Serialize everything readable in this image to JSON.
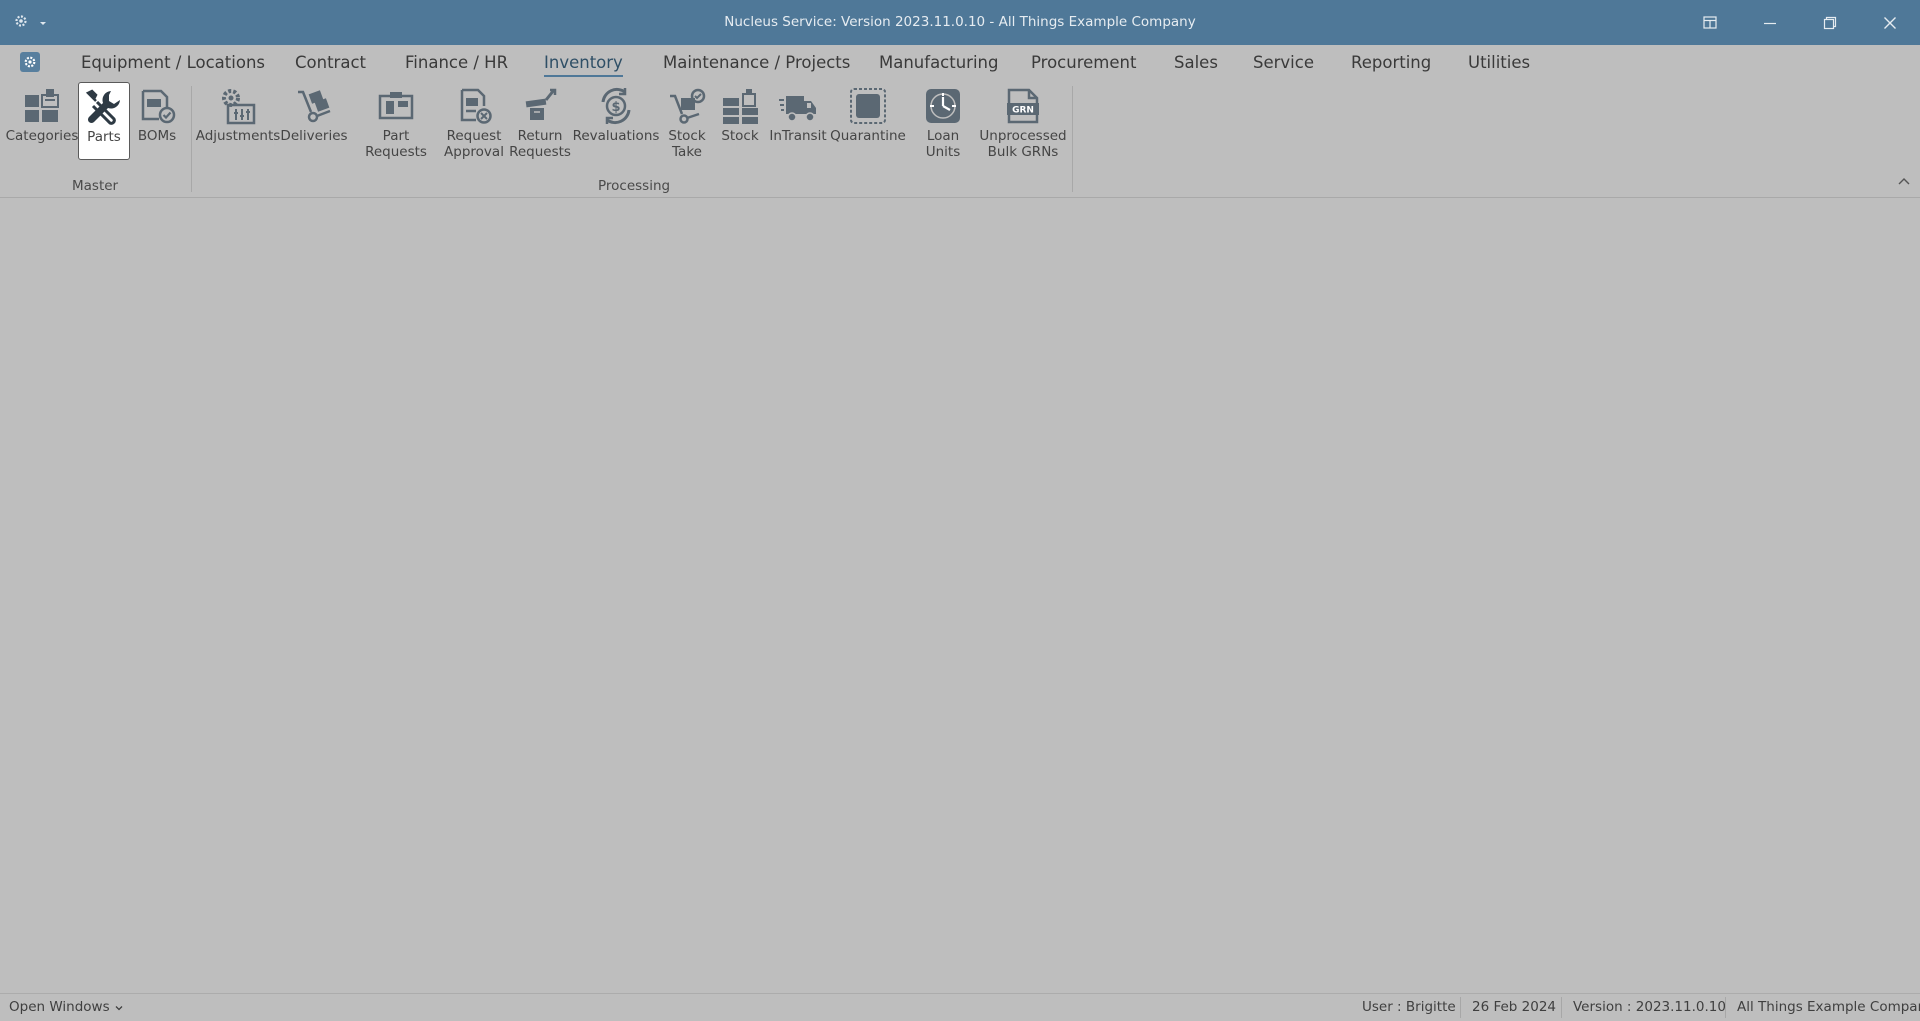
{
  "window": {
    "title": "Nucleus Service: Version 2023.11.0.10 - All Things Example Company"
  },
  "colors": {
    "titlebar": "#4f7898",
    "accent": "#4f7898",
    "background": "#bebebe",
    "icon": "#5f6b75"
  },
  "menu_tabs": [
    {
      "label": "Equipment / Locations"
    },
    {
      "label": "Contract"
    },
    {
      "label": "Finance / HR"
    },
    {
      "label": "Inventory",
      "active": true
    },
    {
      "label": "Maintenance / Projects"
    },
    {
      "label": "Manufacturing"
    },
    {
      "label": "Procurement"
    },
    {
      "label": "Sales"
    },
    {
      "label": "Service"
    },
    {
      "label": "Reporting"
    },
    {
      "label": "Utilities"
    }
  ],
  "ribbon": {
    "master": {
      "label": "Master",
      "buttons": [
        {
          "label": "Categories",
          "icon": "categories-icon"
        },
        {
          "label": "Parts",
          "icon": "wrench-icon",
          "selected": true
        },
        {
          "label": "BOMs",
          "icon": "boms-icon"
        }
      ]
    },
    "processing": {
      "label": "Processing",
      "buttons": [
        {
          "label": "Adjustments",
          "icon": "adjustments-icon"
        },
        {
          "label": "Deliveries",
          "icon": "deliveries-icon"
        },
        {
          "label": "Part Requests",
          "icon": "part-requests-icon"
        },
        {
          "label": "Request",
          "label2": "Approval",
          "icon": "request-approval-icon"
        },
        {
          "label": "Return",
          "label2": "Requests",
          "icon": "return-requests-icon"
        },
        {
          "label": "Revaluations",
          "icon": "revaluations-icon"
        },
        {
          "label": "Stock",
          "label2": "Take",
          "icon": "stock-take-icon"
        },
        {
          "label": "Stock",
          "icon": "stock-icon"
        },
        {
          "label": "InTransit",
          "icon": "truck-icon"
        },
        {
          "label": "Quarantine",
          "icon": "quarantine-icon"
        },
        {
          "label": "Loan Units",
          "icon": "clock-icon"
        },
        {
          "label": "Unprocessed",
          "label2": "Bulk GRNs",
          "icon": "grn-icon",
          "icon_text": "GRN"
        }
      ]
    }
  },
  "status": {
    "open_windows": "Open Windows",
    "user": "User : Brigitte",
    "date": "26 Feb 2024",
    "version": "Version : 2023.11.0.10",
    "company": "All Things Example Company"
  }
}
